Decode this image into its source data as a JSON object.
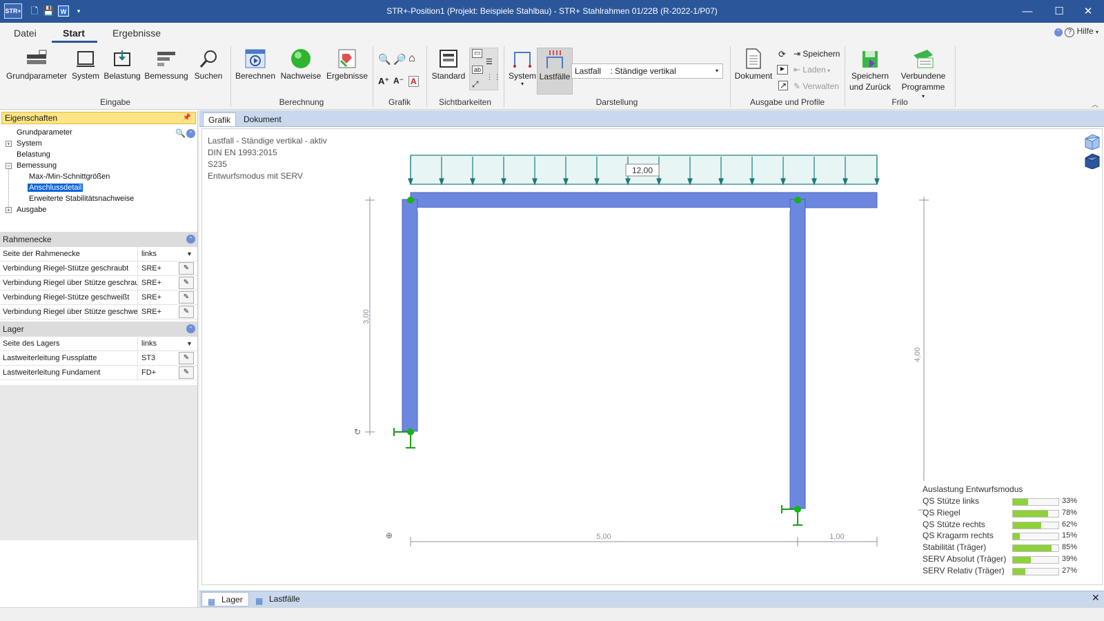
{
  "titlebar": {
    "logo": "STR+",
    "title": "STR+-Position1 (Projekt: Beispiele Stahlbau) - STR+ Stahlrahmen 01/22B (R-2022-1/P07)",
    "minimize": "—",
    "maximize": "☐",
    "close": "✕"
  },
  "tabs": [
    {
      "label": "Datei"
    },
    {
      "label": "Start"
    },
    {
      "label": "Ergebnisse"
    }
  ],
  "help": "Hilfe",
  "ribbon": {
    "eingabe": {
      "grundparameter": "Grundparameter",
      "system": "System",
      "belastung": "Belastung",
      "bemessung": "Bemessung",
      "suchen": "Suchen",
      "group": "Eingabe"
    },
    "berechnung": {
      "berechnen": "Berechnen",
      "nachweise": "Nachweise",
      "ergebnisse": "Ergebnisse",
      "group": "Berechnung"
    },
    "grafik": {
      "group": "Grafik"
    },
    "sichtbarkeiten": {
      "standard": "Standard",
      "group": "Sichtbarkeiten"
    },
    "darstellung": {
      "system": "System",
      "lastfaelle": "Lastfälle",
      "lastfall_label": "Lastfall",
      "lastfall_value": ": Ständige vertikal",
      "group": "Darstellung"
    },
    "ausgabe": {
      "dokument": "Dokument",
      "speichern": "Speichern",
      "laden": "Laden",
      "verwalten": "Verwalten",
      "group": "Ausgabe und Profile"
    },
    "frilo": {
      "speichern_zurueck_1": "Speichern",
      "speichern_zurueck_2": "und Zurück",
      "verbundene_1": "Verbundene",
      "verbundene_2": "Programme",
      "group": "Frilo"
    }
  },
  "eigenschaften": {
    "header": "Eigenschaften",
    "tree": [
      "Grundparameter",
      "System",
      "Belastung",
      "Bemessung",
      "Max-/Min-Schnittgrößen",
      "Anschlussdetail",
      "Erweiterte Stabilitätsnachweise",
      "Ausgabe"
    ]
  },
  "rahmenecke": {
    "title": "Rahmenecke",
    "rows": [
      {
        "key": "Seite der Rahmenecke",
        "value": "links"
      },
      {
        "key": "Verbindung Riegel-Stütze geschraubt",
        "value": "SRE+"
      },
      {
        "key": "Verbindung Riegel über Stütze geschraubt",
        "value": "SRE+"
      },
      {
        "key": "Verbindung Riegel-Stütze geschweißt",
        "value": "SRE+"
      },
      {
        "key": "Verbindung Riegel über Stütze geschweißt",
        "value": "SRE+"
      }
    ]
  },
  "lager": {
    "title": "Lager",
    "rows": [
      {
        "key": "Seite des Lagers",
        "value": "links"
      },
      {
        "key": "Lastweiterleitung Fussplatte",
        "value": "ST3"
      },
      {
        "key": "Lastweiterleitung Fundament",
        "value": "FD+"
      }
    ]
  },
  "doctabs": [
    {
      "label": "Grafik"
    },
    {
      "label": "Dokument"
    }
  ],
  "info": [
    "Lastfall - Ständige vertikal - aktiv",
    "DIN EN 1993:2015",
    "S235",
    "Entwurfsmodus mit SERV"
  ],
  "drawing": {
    "load_value": "12,00",
    "dim_left_height": "3,00",
    "dim_right_height": "4,00",
    "dim_span": "5,00",
    "dim_cantilever": "1,00",
    "frame_color": "#6b87e0",
    "load_color": "#1a7a7a"
  },
  "auslastung": {
    "title": "Auslastung Entwurfsmodus",
    "items": [
      {
        "label": "QS Stütze links",
        "value": "33%",
        "fraction": 0.33
      },
      {
        "label": "QS Riegel",
        "value": "78%",
        "fraction": 0.78
      },
      {
        "label": "QS Stütze rechts",
        "value": "62%",
        "fraction": 0.62
      },
      {
        "label": "QS Kragarm rechts",
        "value": "15%",
        "fraction": 0.15
      },
      {
        "label": "Stabilität (Träger)",
        "value": "85%",
        "fraction": 0.85
      },
      {
        "label": "SERV Absolut (Träger)",
        "value": "39%",
        "fraction": 0.39
      },
      {
        "label": "SERV Relativ (Träger)",
        "value": "27%",
        "fraction": 0.27
      }
    ]
  },
  "bottom_tabs": [
    {
      "label": "Lager"
    },
    {
      "label": "Lastfälle"
    }
  ]
}
